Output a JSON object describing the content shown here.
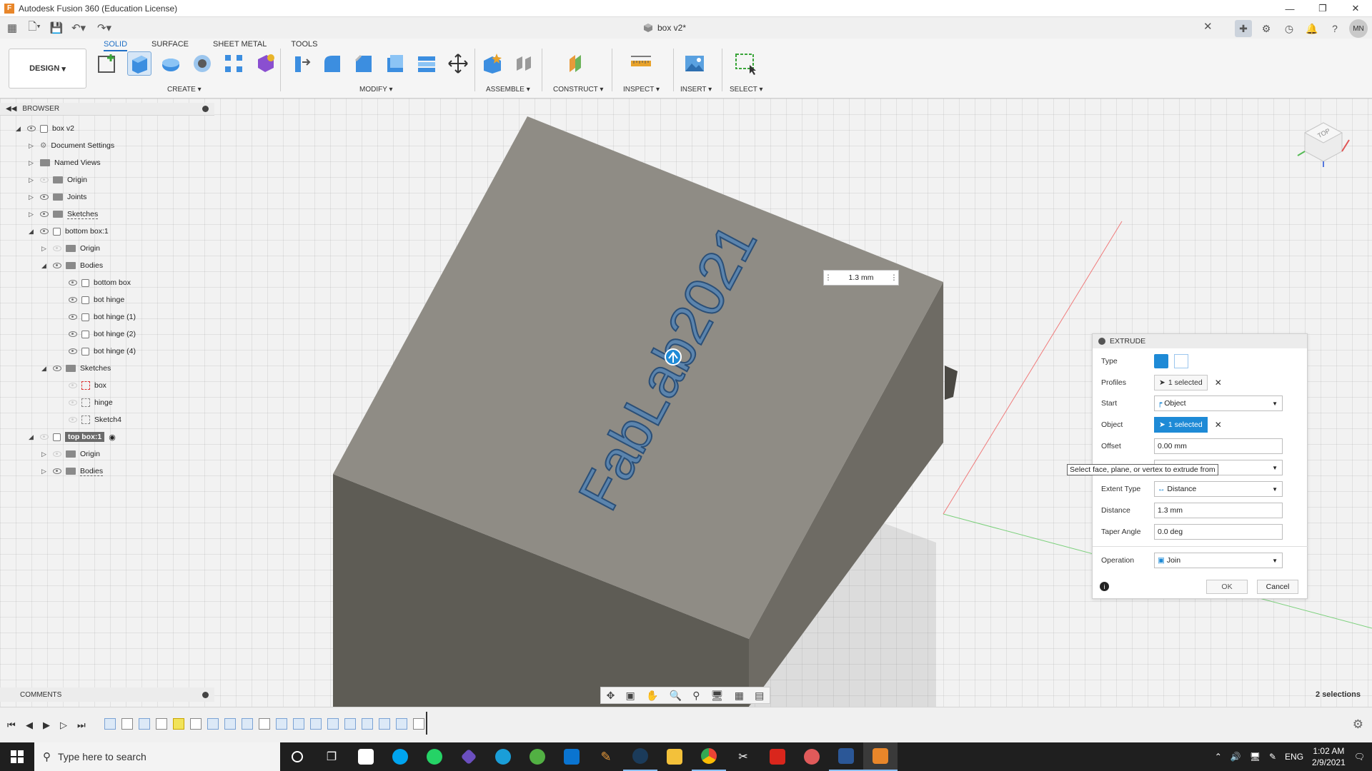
{
  "app": {
    "window_title": "Autodesk Fusion 360 (Education License)",
    "document_tab": "box v2*"
  },
  "user": {
    "initials": "MN"
  },
  "toolbar": {
    "design_label": "DESIGN",
    "tabs": [
      "SOLID",
      "SURFACE",
      "SHEET METAL",
      "TOOLS"
    ],
    "active_tab": "SOLID",
    "groups": {
      "create": "CREATE",
      "modify": "MODIFY",
      "assemble": "ASSEMBLE",
      "construct": "CONSTRUCT",
      "inspect": "INSPECT",
      "insert": "INSERT",
      "select": "SELECT"
    }
  },
  "browser": {
    "title": "BROWSER",
    "items": [
      {
        "label": "box v2"
      },
      {
        "label": "Document Settings"
      },
      {
        "label": "Named Views"
      },
      {
        "label": "Origin"
      },
      {
        "label": "Joints"
      },
      {
        "label": "Sketches"
      },
      {
        "label": "bottom box:1"
      },
      {
        "label": "Origin"
      },
      {
        "label": "Bodies"
      },
      {
        "label": "bottom box"
      },
      {
        "label": "bot hinge"
      },
      {
        "label": "bot hinge (1)"
      },
      {
        "label": "bot hinge (2)"
      },
      {
        "label": "bot hinge (4)"
      },
      {
        "label": "Sketches"
      },
      {
        "label": "box"
      },
      {
        "label": "hinge"
      },
      {
        "label": "Sketch4"
      },
      {
        "label": "top box:1"
      },
      {
        "label": "Origin"
      },
      {
        "label": "Bodies"
      }
    ]
  },
  "viewport": {
    "embossed_text": "FabLab2021",
    "dimension_value": "1.3 mm",
    "view_cube_face": "TOP",
    "tooltip": "Select face, plane, or vertex to extrude from"
  },
  "extrude": {
    "title": "EXTRUDE",
    "type_label": "Type",
    "profiles_label": "Profiles",
    "profiles_value": "1 selected",
    "start_label": "Start",
    "start_value": "Object",
    "object_label": "Object",
    "object_value": "1 selected",
    "offset_label": "Offset",
    "offset_value": "0.00 mm",
    "extent_label": "Extent Type",
    "extent_value": "Distance",
    "distance_label": "Distance",
    "distance_value": "1.3 mm",
    "taper_label": "Taper Angle",
    "taper_value": "0.0 deg",
    "operation_label": "Operation",
    "operation_value": "Join",
    "ok": "OK",
    "cancel": "Cancel"
  },
  "comments": {
    "title": "COMMENTS"
  },
  "status": {
    "selections": "2 selections"
  },
  "taskbar": {
    "search_placeholder": "Type here to search",
    "language": "ENG",
    "time": "1:02 AM",
    "date": "2/9/2021"
  },
  "colors": {
    "accent": "#1e8ad6",
    "box_top": "#8f8c85",
    "box_side": "#5c5a53",
    "text_blue": "#3b6fa3"
  }
}
